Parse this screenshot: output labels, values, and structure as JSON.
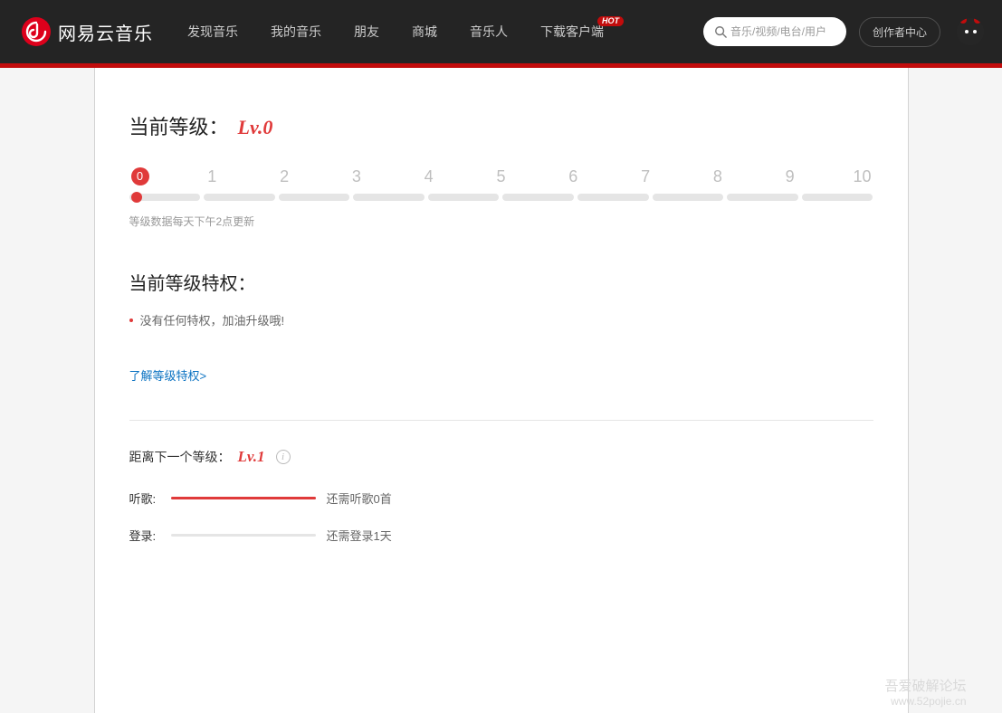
{
  "header": {
    "brand": "网易云音乐",
    "nav": [
      "发现音乐",
      "我的音乐",
      "朋友",
      "商城",
      "音乐人",
      "下载客户端"
    ],
    "hot": "HOT",
    "search_placeholder": "音乐/视频/电台/用户",
    "creator": "创作者中心"
  },
  "level": {
    "title": "当前等级：",
    "current": "Lv.0",
    "scale": [
      "0",
      "1",
      "2",
      "3",
      "4",
      "5",
      "6",
      "7",
      "8",
      "9",
      "10"
    ],
    "note": "等级数据每天下午2点更新"
  },
  "priv": {
    "title": "当前等级特权：",
    "none": "没有任何特权，加油升级哦!",
    "link": "了解等级特权>"
  },
  "next": {
    "title": "距离下一个等级：",
    "level": "Lv.1",
    "songs": {
      "label": "听歌:",
      "text": "还需听歌0首",
      "pct": 100
    },
    "login": {
      "label": "登录:",
      "text": "还需登录1天",
      "pct": 0
    }
  },
  "watermark": {
    "l1": "吾爱破解论坛",
    "l2": "www.52pojie.cn"
  }
}
